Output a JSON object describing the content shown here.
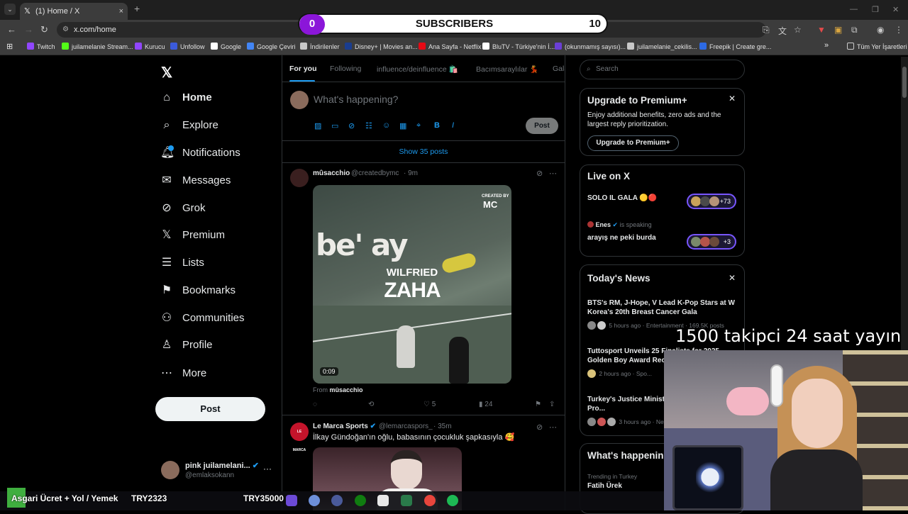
{
  "browser": {
    "tab_title": "(1) Home / X",
    "new_tab": "+",
    "tab_close": "×",
    "url": "x.com/home",
    "bookmarks": [
      {
        "label": "Twitch",
        "color": "#9146ff"
      },
      {
        "label": "juilamelanie Stream...",
        "color": "#53fc18"
      },
      {
        "label": "Kurucu",
        "color": "#9146ff"
      },
      {
        "label": "Unfollow",
        "color": "#3b5bdb"
      },
      {
        "label": "Google",
        "color": "#ffffff"
      },
      {
        "label": "Google Çeviri",
        "color": "#4285f4"
      },
      {
        "label": "İndirilenler",
        "color": "#c8c8c8"
      },
      {
        "label": "Disney+ | Movies an...",
        "color": "#1a3d8f"
      },
      {
        "label": "Ana Sayfa - Netflix",
        "color": "#e50914"
      },
      {
        "label": "BluTV - Türkiye'nin İ...",
        "color": "#ffffff"
      },
      {
        "label": "(okunmamış sayısı)...",
        "color": "#6b3fd6"
      },
      {
        "label": "juilamelanie_cekilis...",
        "color": "#c8c8c8"
      },
      {
        "label": "Freepik | Create gre...",
        "color": "#2d6ae3"
      }
    ],
    "bookmarks_more": "»",
    "other_bookmarks": "Tüm Yer İşaretleri"
  },
  "subscribers": {
    "count": "0",
    "label": "SUBSCRIBERS",
    "goal": "10"
  },
  "sidebar": {
    "logo": "𝕏",
    "items": [
      {
        "label": "Home",
        "icon": "⌂",
        "icon_name": "home-icon"
      },
      {
        "label": "Explore",
        "icon": "⌕",
        "icon_name": "search-icon"
      },
      {
        "label": "Notifications",
        "icon": "🔔︎",
        "icon_name": "bell-icon"
      },
      {
        "label": "Messages",
        "icon": "✉",
        "icon_name": "envelope-icon"
      },
      {
        "label": "Grok",
        "icon": "⊘",
        "icon_name": "grok-icon"
      },
      {
        "label": "Premium",
        "icon": "𝕏",
        "icon_name": "x-premium-icon"
      },
      {
        "label": "Lists",
        "icon": "☰",
        "icon_name": "list-icon"
      },
      {
        "label": "Bookmarks",
        "icon": "⚑",
        "icon_name": "bookmark-icon"
      },
      {
        "label": "Communities",
        "icon": "⚇",
        "icon_name": "communities-icon"
      },
      {
        "label": "Profile",
        "icon": "♙",
        "icon_name": "profile-icon"
      },
      {
        "label": "More",
        "icon": "⋯",
        "icon_name": "more-icon"
      }
    ],
    "post_button": "Post",
    "account_name": "pink juilamelani...",
    "account_handle": "@emlaksokann",
    "account_more": "···"
  },
  "feed": {
    "tabs": [
      "For you",
      "Following",
      "influence/deinfluence 🛍️",
      "Bacımsaraylılar 💃",
      "Gala"
    ],
    "composer_placeholder": "What's happening?",
    "composer_post": "Post",
    "show_posts": "Show 35 posts",
    "tweets": [
      {
        "name": "mûsacchio",
        "handle": "@createdbymc",
        "time": "· 9m",
        "video_text_1": "WILFRIED",
        "video_text_2": "ZAHA",
        "video_brand": "be' ay",
        "video_watermark_top": "CREATED BY",
        "video_watermark": "MC",
        "duration": "0:09",
        "from_label": "From",
        "from_name": "mûsacchio",
        "likes": "5",
        "views": "24"
      },
      {
        "name": "Le Marca Sports",
        "handle": "@lemarcaspors_",
        "time": "· 35m",
        "text": "İlkay Gündoğan'ın oğlu, babasının çocukluk şapkasıyla 🥰",
        "avatar_text": "LE MARCA"
      }
    ]
  },
  "right": {
    "search_placeholder": "Search",
    "premium": {
      "title": "Upgrade to Premium+",
      "desc": "Enjoy additional benefits, zero ads and the largest reply prioritization.",
      "button": "Upgrade to Premium+"
    },
    "live": {
      "title": "Live on X",
      "spaces": [
        {
          "title": "SOLO IL GALA 🟡🔴",
          "count": "+73"
        },
        {
          "host": "Enes",
          "status": "is speaking",
          "title": "arayış ne peki burda",
          "count": "+3"
        }
      ]
    },
    "news": {
      "title": "Today's News",
      "items": [
        {
          "title": "BTS's RM, J-Hope, V Lead K-Pop Stars at W Korea's 20th Breast Cancer Gala",
          "meta": "5 hours ago · Entertainment · 169.5K posts"
        },
        {
          "title": "Tuttosport Unveils 25 Finalists for 2025 Golden Boy Award Rec...",
          "meta": "2 hours ago · Spo..."
        },
        {
          "title": "Turkey's Justice Minist... Terms for LGBTQ+ Pro...",
          "meta": "3 hours ago · New..."
        }
      ]
    },
    "happening": {
      "title": "What's happening",
      "trend_context": "Trending in Turkey",
      "trend": "Fatih Ürek"
    }
  },
  "overlay": {
    "banner": "1500 takipci 24 saat yayın",
    "ticker": [
      "Asgari Ücret + Yol / Yemek",
      "TRY2323",
      "TRY35000"
    ]
  }
}
